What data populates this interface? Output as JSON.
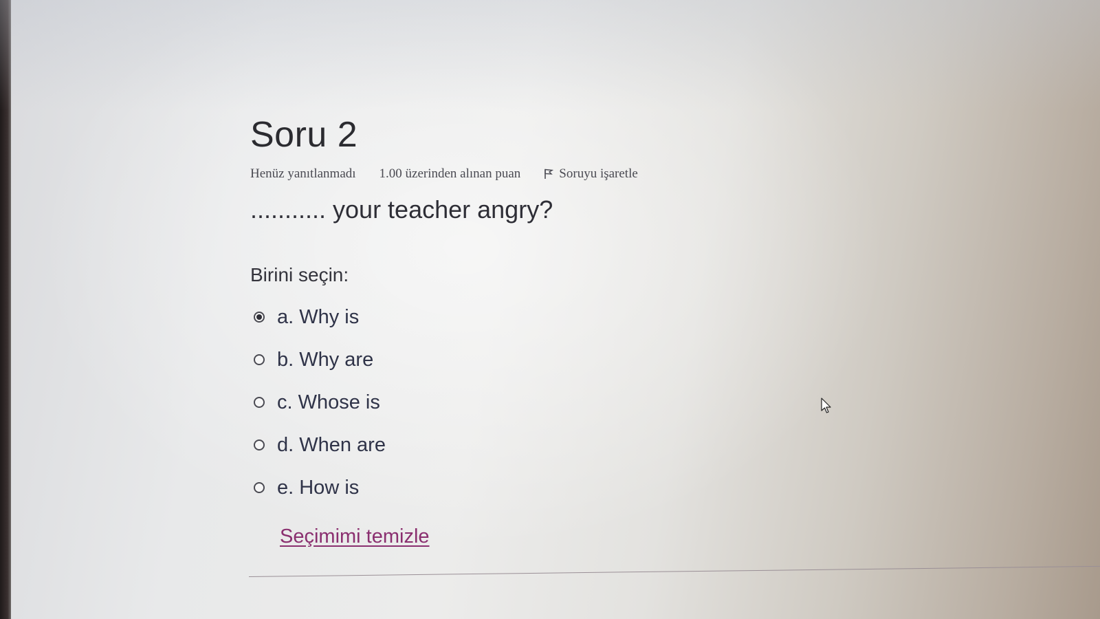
{
  "question": {
    "title": "Soru 2",
    "status": "Henüz yanıtlanmadı",
    "points": "1.00 üzerinden alınan puan",
    "flag_label": "Soruyu işaretle",
    "text": "........... your teacher angry?",
    "prompt": "Birini seçin:",
    "options": [
      {
        "label": "a. Why is",
        "selected": true
      },
      {
        "label": "b. Why are",
        "selected": false
      },
      {
        "label": "c. Whose is",
        "selected": false
      },
      {
        "label": "d. When are",
        "selected": false
      },
      {
        "label": "e. How is",
        "selected": false
      }
    ],
    "clear_label": "Seçimimi temizle"
  },
  "colors": {
    "link": "#8a2f6f",
    "text": "#2e2e36"
  },
  "icons": {
    "flag": "flag-icon",
    "cursor": "mouse-pointer-icon"
  }
}
